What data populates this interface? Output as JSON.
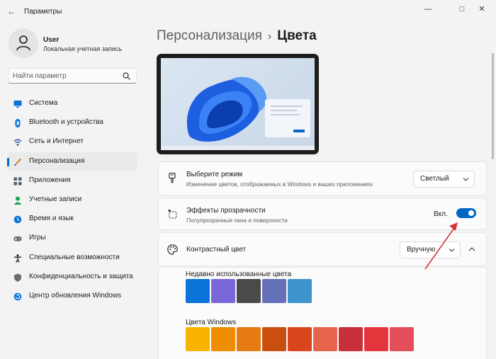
{
  "window": {
    "title": "Параметры",
    "back_icon": "back-arrow-icon",
    "controls": [
      "minimize-icon",
      "maximize-icon",
      "close-icon"
    ]
  },
  "user": {
    "name": "User",
    "account_type": "Локальная учетная запись"
  },
  "search": {
    "placeholder": "Найти параметр"
  },
  "sidebar": {
    "items": [
      {
        "label": "Система",
        "icon": "monitor-icon",
        "color": "#0a74d9"
      },
      {
        "label": "Bluetooth и устройства",
        "icon": "bluetooth-icon",
        "color": "#0a74d9"
      },
      {
        "label": "Сеть и Интернет",
        "icon": "wifi-icon",
        "color": "#2b5797"
      },
      {
        "label": "Персонализация",
        "icon": "brush-icon",
        "color": "#e07a1f",
        "active": true
      },
      {
        "label": "Приложения",
        "icon": "apps-icon",
        "color": "#52606d"
      },
      {
        "label": "Учетные записи",
        "icon": "person-icon",
        "color": "#1fa15b"
      },
      {
        "label": "Время и язык",
        "icon": "globe-clock-icon",
        "color": "#0a74d9"
      },
      {
        "label": "Игры",
        "icon": "gamepad-icon",
        "color": "#5b6670"
      },
      {
        "label": "Специальные возможности",
        "icon": "accessibility-icon",
        "color": "#1b1b1b"
      },
      {
        "label": "Конфиденциальность и защита",
        "icon": "shield-icon",
        "color": "#6b6b6b"
      },
      {
        "label": "Центр обновления Windows",
        "icon": "update-icon",
        "color": "#0a74d9"
      }
    ]
  },
  "breadcrumb": {
    "parent": "Персонализация",
    "separator": "›",
    "current": "Цвета"
  },
  "settings": {
    "mode": {
      "title": "Выберите режим",
      "subtitle": "Изменение цветов, отображаемых в Windows и ваших приложениях",
      "value": "Светлый",
      "icon": "brush-mode-icon"
    },
    "transparency": {
      "title": "Эффекты прозрачности",
      "subtitle": "Полупрозрачные окна и поверхности",
      "state_label": "Вкл.",
      "enabled": true,
      "icon": "transparency-icon"
    },
    "accent": {
      "title": "Контрастный цвет",
      "value": "Вручную",
      "icon": "palette-icon",
      "expanded": true
    }
  },
  "colors": {
    "recent_label": "Недавно использованные цвета",
    "recent": [
      "#0a74d9",
      "#7a68db",
      "#4a4a4a",
      "#6470b8",
      "#3e94cc"
    ],
    "windows_label": "Цвета Windows",
    "windows": [
      "#f8b400",
      "#f08c00",
      "#e67a14",
      "#c94f0f",
      "#d9461e",
      "#e8654d",
      "#c8303d",
      "#e3363c",
      "#e34e5a"
    ]
  },
  "theme": {
    "accent": "#0067c0",
    "background": "#f3f3f3",
    "card": "#fbfbfb",
    "annotation_arrow": "#d8353b"
  }
}
